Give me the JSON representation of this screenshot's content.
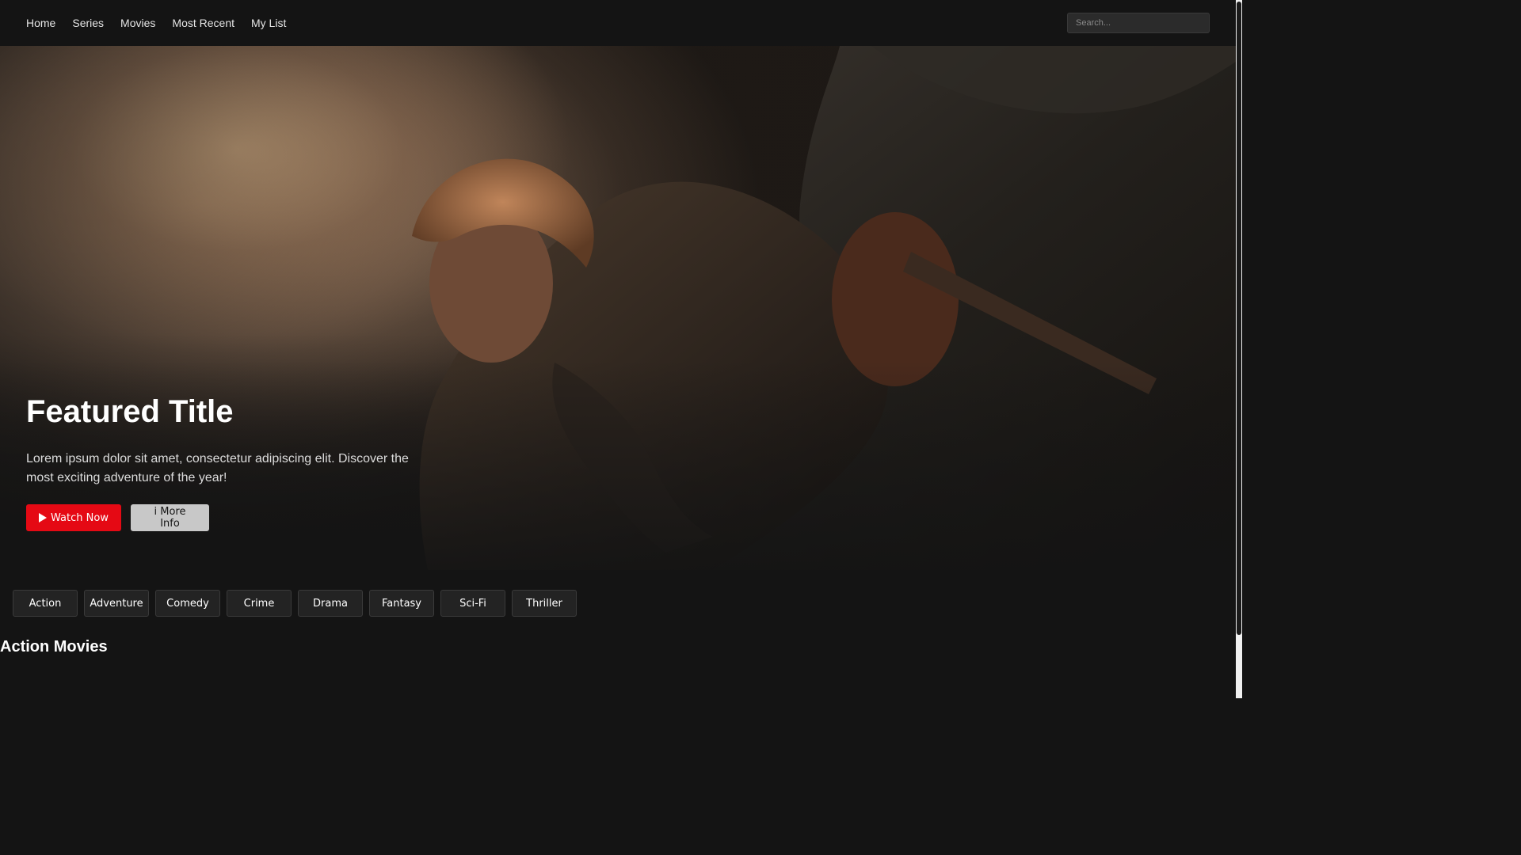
{
  "nav": {
    "links": [
      {
        "label": "Home"
      },
      {
        "label": "Series"
      },
      {
        "label": "Movies"
      },
      {
        "label": "Most Recent"
      },
      {
        "label": "My List"
      }
    ],
    "search_placeholder": "Search..."
  },
  "hero": {
    "title": "Featured Title",
    "description": "Lorem ipsum dolor sit amet, consectetur adipiscing elit. Discover the most exciting adventure of the year!",
    "watch_label": "Watch Now",
    "info_label": "i More Info"
  },
  "genres": [
    {
      "label": "Action"
    },
    {
      "label": "Adventure"
    },
    {
      "label": "Comedy"
    },
    {
      "label": "Crime"
    },
    {
      "label": "Drama"
    },
    {
      "label": "Fantasy"
    },
    {
      "label": "Sci-Fi"
    },
    {
      "label": "Thriller"
    }
  ],
  "section": {
    "title": "Action Movies"
  },
  "colors": {
    "background": "#141414",
    "accent": "#e50914",
    "info_button": "#c8c8c8",
    "genre_button": "#232323"
  }
}
